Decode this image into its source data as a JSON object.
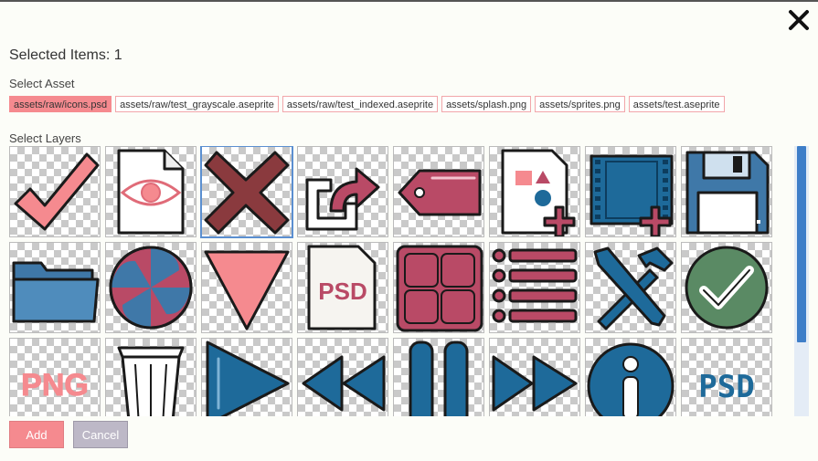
{
  "dialog": {
    "selected_items": "Selected Items: 1",
    "select_asset_label": "Select Asset",
    "select_layers_label": "Select Layers",
    "close_icon": "close-icon"
  },
  "assets": [
    {
      "label": "assets/raw/icons.psd",
      "active": true
    },
    {
      "label": "assets/raw/test_grayscale.aseprite",
      "active": false
    },
    {
      "label": "assets/raw/test_indexed.aseprite",
      "active": false
    },
    {
      "label": "assets/splash.png",
      "active": false
    },
    {
      "label": "assets/sprites.png",
      "active": false
    },
    {
      "label": "assets/test.aseprite",
      "active": false
    }
  ],
  "layers": [
    {
      "icon": "checkmark-icon",
      "selected": false
    },
    {
      "icon": "eye-document-icon",
      "selected": false
    },
    {
      "icon": "x-cross-icon",
      "selected": true
    },
    {
      "icon": "export-arrow-icon",
      "selected": false
    },
    {
      "icon": "tag-icon",
      "selected": false
    },
    {
      "icon": "new-image-icon",
      "selected": false
    },
    {
      "icon": "new-film-icon",
      "selected": false
    },
    {
      "icon": "floppy-disk-icon",
      "selected": false
    },
    {
      "icon": "folder-icon",
      "selected": false
    },
    {
      "icon": "spinner-ball-icon",
      "selected": false
    },
    {
      "icon": "triangle-down-icon",
      "selected": false
    },
    {
      "icon": "psd-file-icon",
      "selected": false
    },
    {
      "icon": "grid-layout-icon",
      "selected": false
    },
    {
      "icon": "list-icon",
      "selected": false
    },
    {
      "icon": "tools-icon",
      "selected": false
    },
    {
      "icon": "check-circle-icon",
      "selected": false
    },
    {
      "icon": "png-text-icon",
      "selected": false,
      "text": "PNG"
    },
    {
      "icon": "trash-icon",
      "selected": false
    },
    {
      "icon": "play-icon",
      "selected": false
    },
    {
      "icon": "rewind-icon",
      "selected": false
    },
    {
      "icon": "pause-icon",
      "selected": false
    },
    {
      "icon": "fast-forward-icon",
      "selected": false
    },
    {
      "icon": "info-icon",
      "selected": false
    },
    {
      "icon": "psd-text-icon",
      "selected": false,
      "text": "PSD"
    }
  ],
  "psd_file_text": "PSD",
  "buttons": {
    "add": "Add",
    "cancel": "Cancel"
  },
  "colors": {
    "accent": "#f58a8f",
    "blue": "#1e6a9a",
    "maroon": "#b94a66",
    "scroll": "#3e7ec8"
  }
}
